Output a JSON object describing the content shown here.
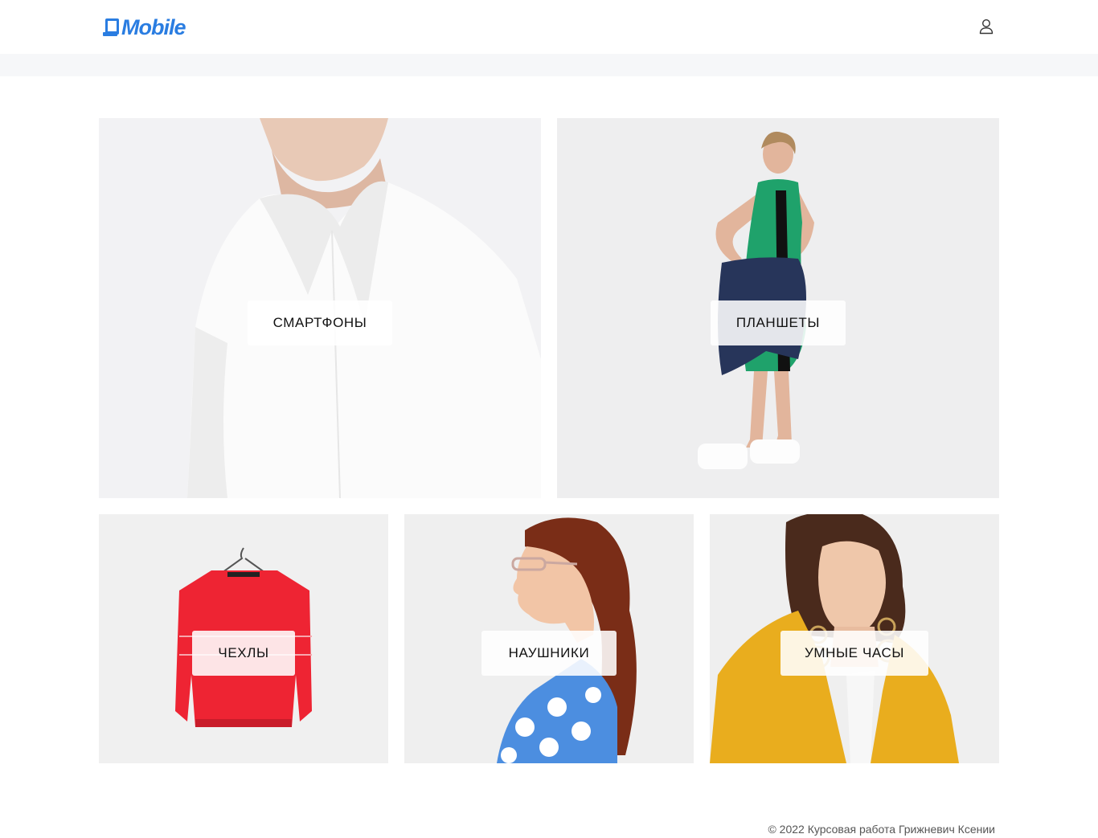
{
  "brand": {
    "name": "Mobile",
    "color": "#2a7de1"
  },
  "header": {
    "user_icon": "user-icon"
  },
  "categories": [
    {
      "label": "СМАРТФОНЫ"
    },
    {
      "label": "ПЛАНШЕТЫ"
    },
    {
      "label": "ЧЕХЛЫ"
    },
    {
      "label": "НАУШНИКИ"
    },
    {
      "label": "УМНЫЕ ЧАСЫ"
    }
  ],
  "footer": {
    "copyright": "© 2022 Курсовая работа Грижневич Ксении"
  }
}
